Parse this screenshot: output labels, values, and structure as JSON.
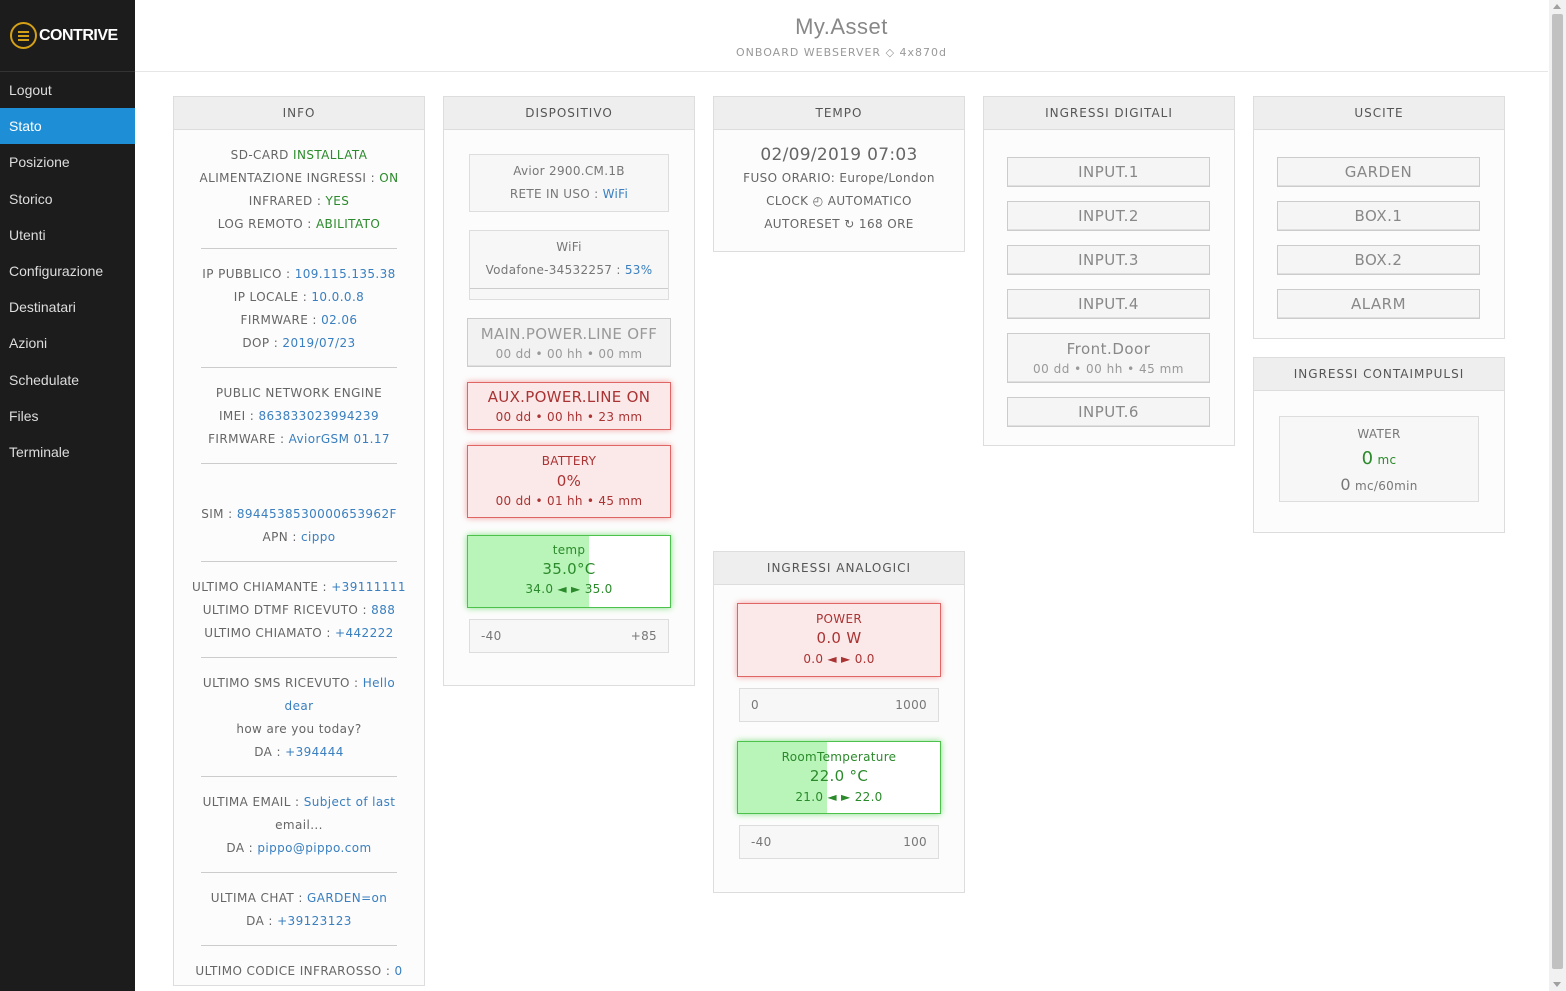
{
  "logo": {
    "text": "CONTRIVE"
  },
  "nav": [
    "Logout",
    "Stato",
    "Posizione",
    "Storico",
    "Utenti",
    "Configurazione",
    "Destinatari",
    "Azioni",
    "Schedulate",
    "Files",
    "Terminale"
  ],
  "header": {
    "title": "My.Asset",
    "subtitle": "ONBOARD WEBSERVER ◇ 4x870d"
  },
  "info": {
    "title": "INFO",
    "sd_label": "SD-CARD",
    "sd_value": "INSTALLATA",
    "alim_label": "ALIMENTAZIONE INGRESSI :",
    "alim_value": "ON",
    "ir_label": "INFRARED :",
    "ir_value": "YES",
    "log_label": "LOG REMOTO :",
    "log_value": "ABILITATO",
    "ip_pub_label": "IP PUBBLICO :",
    "ip_pub_value": "109.115.135.38",
    "ip_loc_label": "IP LOCALE :",
    "ip_loc_value": "10.0.0.8",
    "fw_label": "FIRMWARE :",
    "fw_value": "02.06",
    "dop_label": "DOP :",
    "dop_value": "2019/07/23",
    "pne": "PUBLIC NETWORK ENGINE",
    "imei_label": "IMEI :",
    "imei_value": "863833023994239",
    "fw2_label": "FIRMWARE :",
    "fw2_value": "AviorGSM 01.17",
    "sim_label": "SIM :",
    "sim_value": "8944538530000653962F",
    "apn_label": "APN :",
    "apn_value": "cippo",
    "chiamante_label": "ULTIMO CHIAMANTE :",
    "chiamante_value": "+39111111",
    "dtmf_label": "ULTIMO DTMF RICEVUTO :",
    "dtmf_value": "888",
    "chiamato_label": "ULTIMO CHIAMATO :",
    "chiamato_value": "+442222",
    "sms_label": "ULTIMO SMS RICEVUTO :",
    "sms_value_1": "Hello dear",
    "sms_value_2": "how are you today?",
    "sms_da_label": "DA :",
    "sms_da_value": "+394444",
    "email_label": "ULTIMA EMAIL :",
    "email_value_1": "Subject of last",
    "email_value_2": "email...",
    "email_da_label": "DA :",
    "email_da_value": "pippo@pippo.com",
    "chat_label": "ULTIMA CHAT :",
    "chat_value": "GARDEN=on",
    "chat_da_label": "DA :",
    "chat_da_value": "+39123123",
    "ir_code_label": "ULTIMO CODICE INFRAROSSO :",
    "ir_code_value": "0"
  },
  "dispositivo": {
    "title": "DISPOSITIVO",
    "model": "Avior 2900.CM.1B",
    "rete_label": "RETE IN USO :",
    "rete_value": "WiFi",
    "wifi_title": "WiFi",
    "wifi_ssid": "Vodafone-34532257 :",
    "wifi_signal": "53%",
    "main_title": "MAIN.POWER.LINE OFF",
    "main_time": "00 dd • 00 hh • 00 mm",
    "aux_title": "AUX.POWER.LINE ON",
    "aux_time": "00 dd • 00 hh • 23 mm",
    "battery_title": "BATTERY",
    "battery_value": "0%",
    "battery_time": "00 dd • 01 hh • 45 mm",
    "temp_title": "temp",
    "temp_value": "35.0°C",
    "temp_range": "34.0 ◄ ► 35.0",
    "temp_fill": 0.6,
    "temp_min": "-40",
    "temp_max": "+85"
  },
  "tempo": {
    "title": "TEMPO",
    "datetime": "02/09/2019 07:03",
    "fuso": "FUSO ORARIO: Europe/London",
    "clock": "CLOCK ◴ AUTOMATICO",
    "autoreset": "AUTORESET ↻ 168 ORE"
  },
  "analogici": {
    "title": "INGRESSI ANALOGICI",
    "power_title": "POWER",
    "power_value": "0.0 W",
    "power_range": "0.0 ◄ ► 0.0",
    "power_min": "0",
    "power_max": "1000",
    "room_title": "RoomTemperature",
    "room_value": "22.0 °C",
    "room_range": "21.0 ◄ ► 22.0",
    "room_fill": 0.44,
    "room_min": "-40",
    "room_max": "100"
  },
  "digitali": {
    "title": "INGRESSI DIGITALI",
    "inputs": [
      "INPUT.1",
      "INPUT.2",
      "INPUT.3",
      "INPUT.4"
    ],
    "front_title": "Front.Door",
    "front_time": "00 dd • 00 hh • 45 mm",
    "input6": "INPUT.6"
  },
  "uscite": {
    "title": "USCITE",
    "outputs": [
      "GARDEN",
      "BOX.1",
      "BOX.2",
      "ALARM"
    ]
  },
  "contaimpulsi": {
    "title": "INGRESSI CONTAIMPULSI",
    "name": "WATER",
    "value": "0",
    "unit": "mc",
    "rate": "0",
    "rate_unit": "mc/60min"
  }
}
